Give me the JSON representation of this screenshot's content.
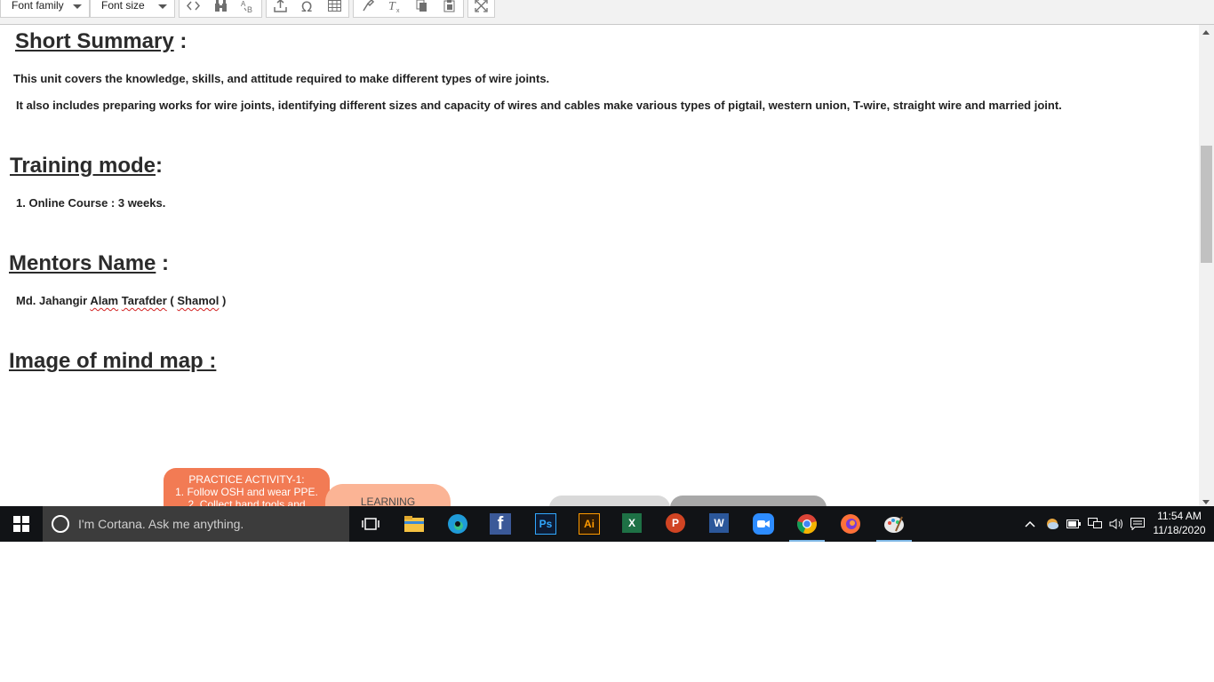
{
  "toolbar": {
    "font_family_label": "Font family",
    "font_size_label": "Font size"
  },
  "content": {
    "summary_heading": "Short Summary",
    "summary_colon": " :",
    "summary_p1": "This unit covers the knowledge, skills, and attitude required to make different types of wire joints.",
    "summary_p2": "It also includes preparing works for wire joints, identifying different sizes and capacity of wires and cables make various types of pigtail, western union, T-wire, straight wire and married joint.",
    "training_heading": "Training mode",
    "training_colon": ":",
    "training_item": "1. Online Course : 3 weeks.",
    "mentors_heading": "Mentors Name",
    "mentors_colon": " :",
    "mentor_part1": "Md. Jahangir ",
    "mentor_alam": "Alam",
    "mentor_space": " ",
    "mentor_tarafder": "Tarafder",
    "mentor_part2": " ( ",
    "mentor_shamol": "Shamol",
    "mentor_part3": " )",
    "mindmap_heading": "Image of mind map :"
  },
  "mindmap": {
    "node1_line1": "PRACTICE ACTIVITY-1:",
    "node1_line2": "1. Follow OSH and wear PPE.",
    "node1_line3": "2. Collect hand tools and",
    "node2_line1": "LEARNING"
  },
  "taskbar": {
    "search_placeholder": "I'm Cortana. Ask me anything.",
    "time": "11:54 AM",
    "date": "11/18/2020",
    "apps": [
      "task-view",
      "file-explorer",
      "edge",
      "facebook",
      "photoshop",
      "illustrator",
      "excel",
      "powerpoint",
      "word",
      "zoom",
      "chrome",
      "firefox",
      "paint"
    ]
  },
  "colors": {
    "taskbar_bg": "#111316",
    "mindmap_node1": "#f27b54",
    "mindmap_node2": "#fbb495"
  }
}
